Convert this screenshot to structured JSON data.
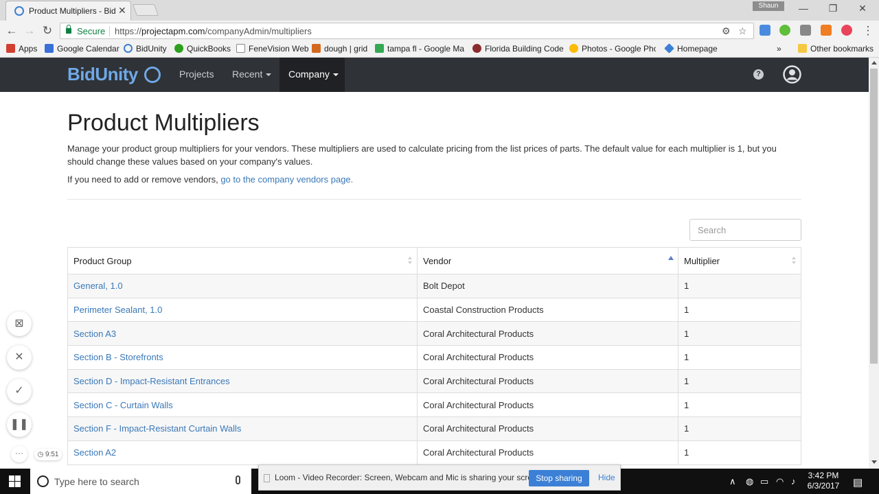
{
  "browser": {
    "tab_title": "Product Multipliers - BidUnity",
    "tab_close": "✕",
    "profile_name": "Shaun",
    "secure_label": "Secure",
    "url_scheme": "https://",
    "url_host": "projectapm.com",
    "url_path": "/companyAdmin/multipliers",
    "bookmarks": [
      {
        "label": "Apps",
        "color": "#d23f31"
      },
      {
        "label": "Google Calendar",
        "color": "#3b6fd8"
      },
      {
        "label": "BidUnity",
        "color": "#3b7fd1"
      },
      {
        "label": "QuickBooks",
        "color": "#2ca01c"
      },
      {
        "label": "FeneVision Web",
        "color": "#888888"
      },
      {
        "label": "dough | grid",
        "color": "#d2691e"
      },
      {
        "label": "tampa fl - Google Ma",
        "color": "#34a853"
      },
      {
        "label": "Florida Building Code",
        "color": "#8b2d2d"
      },
      {
        "label": "Photos - Google Phot",
        "color": "#fbbc05"
      },
      {
        "label": "Homepage",
        "color": "#3b80d6"
      }
    ],
    "more_bookmarks": "»",
    "other_bookmarks": "Other bookmarks"
  },
  "navbar": {
    "brand": "BidUnity",
    "projects": "Projects",
    "recent": "Recent",
    "company": "Company",
    "help": "?"
  },
  "page": {
    "title": "Product Multipliers",
    "intro": "Manage your product group multipliers for your vendors. These multipliers are used to calculate pricing from the list prices of parts. The default value for each multiplier is 1, but you should change these values based on your company's values.",
    "vendor_note_prefix": "If you need to add or remove vendors, ",
    "vendor_note_link": "go to the company vendors page.",
    "search_placeholder": "Search"
  },
  "table": {
    "headers": [
      "Product Group",
      "Vendor",
      "Multiplier"
    ],
    "rows": [
      {
        "group": "General, 1.0",
        "vendor": "Bolt Depot",
        "multiplier": "1"
      },
      {
        "group": "Perimeter Sealant, 1.0",
        "vendor": "Coastal Construction Products",
        "multiplier": "1"
      },
      {
        "group": "Section A3",
        "vendor": "Coral Architectural Products",
        "multiplier": "1"
      },
      {
        "group": "Section B - Storefronts",
        "vendor": "Coral Architectural Products",
        "multiplier": "1"
      },
      {
        "group": "Section D - Impact-Resistant Entrances",
        "vendor": "Coral Architectural Products",
        "multiplier": "1"
      },
      {
        "group": "Section C - Curtain Walls",
        "vendor": "Coral Architectural Products",
        "multiplier": "1"
      },
      {
        "group": "Section F - Impact-Resistant Curtain Walls",
        "vendor": "Coral Architectural Products",
        "multiplier": "1"
      },
      {
        "group": "Section A2",
        "vendor": "Coral Architectural Products",
        "multiplier": "1"
      }
    ]
  },
  "loom": {
    "timer": "9:51",
    "more": "···",
    "share_message": "Loom - Video Recorder: Screen, Webcam and Mic is sharing your screen.",
    "stop_sharing": "Stop sharing",
    "hide": "Hide"
  },
  "taskbar": {
    "search_placeholder": "Type here to search",
    "time": "3:42 PM",
    "date": "6/3/2017"
  },
  "colors": {
    "navbar_bg": "#2f3236",
    "brand": "#6fa8e8",
    "link": "#3a78b8",
    "accent_blue": "#3b80d6"
  }
}
